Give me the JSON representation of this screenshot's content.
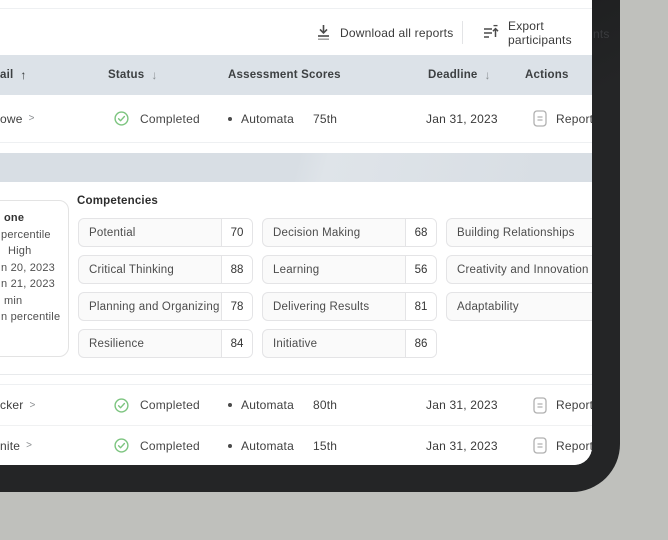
{
  "toolbar": {
    "download_label": "Download all reports",
    "export_label": "Export participants",
    "export_overflow": "nts"
  },
  "table": {
    "header": {
      "email_fragment": "ail",
      "email_sort": "↑",
      "status_label": "Status",
      "status_sort": "↓",
      "scores_label": "Assessment Scores",
      "deadline_label": "Deadline",
      "deadline_sort": "↓",
      "actions_label": "Actions"
    },
    "rows": [
      {
        "name": "owe",
        "chevron": ">",
        "status": "Completed",
        "provider": "Automata",
        "percentile": "75th",
        "deadline": "Jan 31, 2023",
        "action": "Report"
      },
      {
        "name": "cker",
        "chevron": ">",
        "status": "Completed",
        "provider": "Automata",
        "percentile": "80th",
        "deadline": "Jan 31, 2023",
        "action": "Report"
      },
      {
        "name": "nite",
        "chevron": ">",
        "status": "Completed",
        "provider": "Automata",
        "percentile": "15th",
        "deadline": "Jan 31, 2023",
        "action": "Report"
      }
    ]
  },
  "details": {
    "card_lines": [
      "one",
      "percentile",
      "High",
      "n 20, 2023",
      "n 21, 2023",
      "min",
      "n percentile"
    ],
    "competencies": {
      "title": "Competencies",
      "columns": [
        [
          {
            "label": "Potential",
            "score": "70"
          },
          {
            "label": "Critical Thinking",
            "score": "88"
          },
          {
            "label": "Planning and Organizing",
            "score": "78"
          },
          {
            "label": "Resilience",
            "score": "84"
          }
        ],
        [
          {
            "label": "Decision Making",
            "score": "68"
          },
          {
            "label": "Learning",
            "score": "56"
          },
          {
            "label": "Delivering Results",
            "score": "81"
          },
          {
            "label": "Initiative",
            "score": "86"
          }
        ],
        [
          {
            "label": "Building Relationships"
          },
          {
            "label": "Creativity and Innovation"
          },
          {
            "label": "Adaptability"
          }
        ]
      ]
    }
  },
  "colors": {
    "page_background": "#bfc0bc",
    "frame": "#242526",
    "header_background": "#dce2e8",
    "band_background": "#d8dee4",
    "status_green": "#7cc47f",
    "text_primary": "#3f3f3f"
  }
}
